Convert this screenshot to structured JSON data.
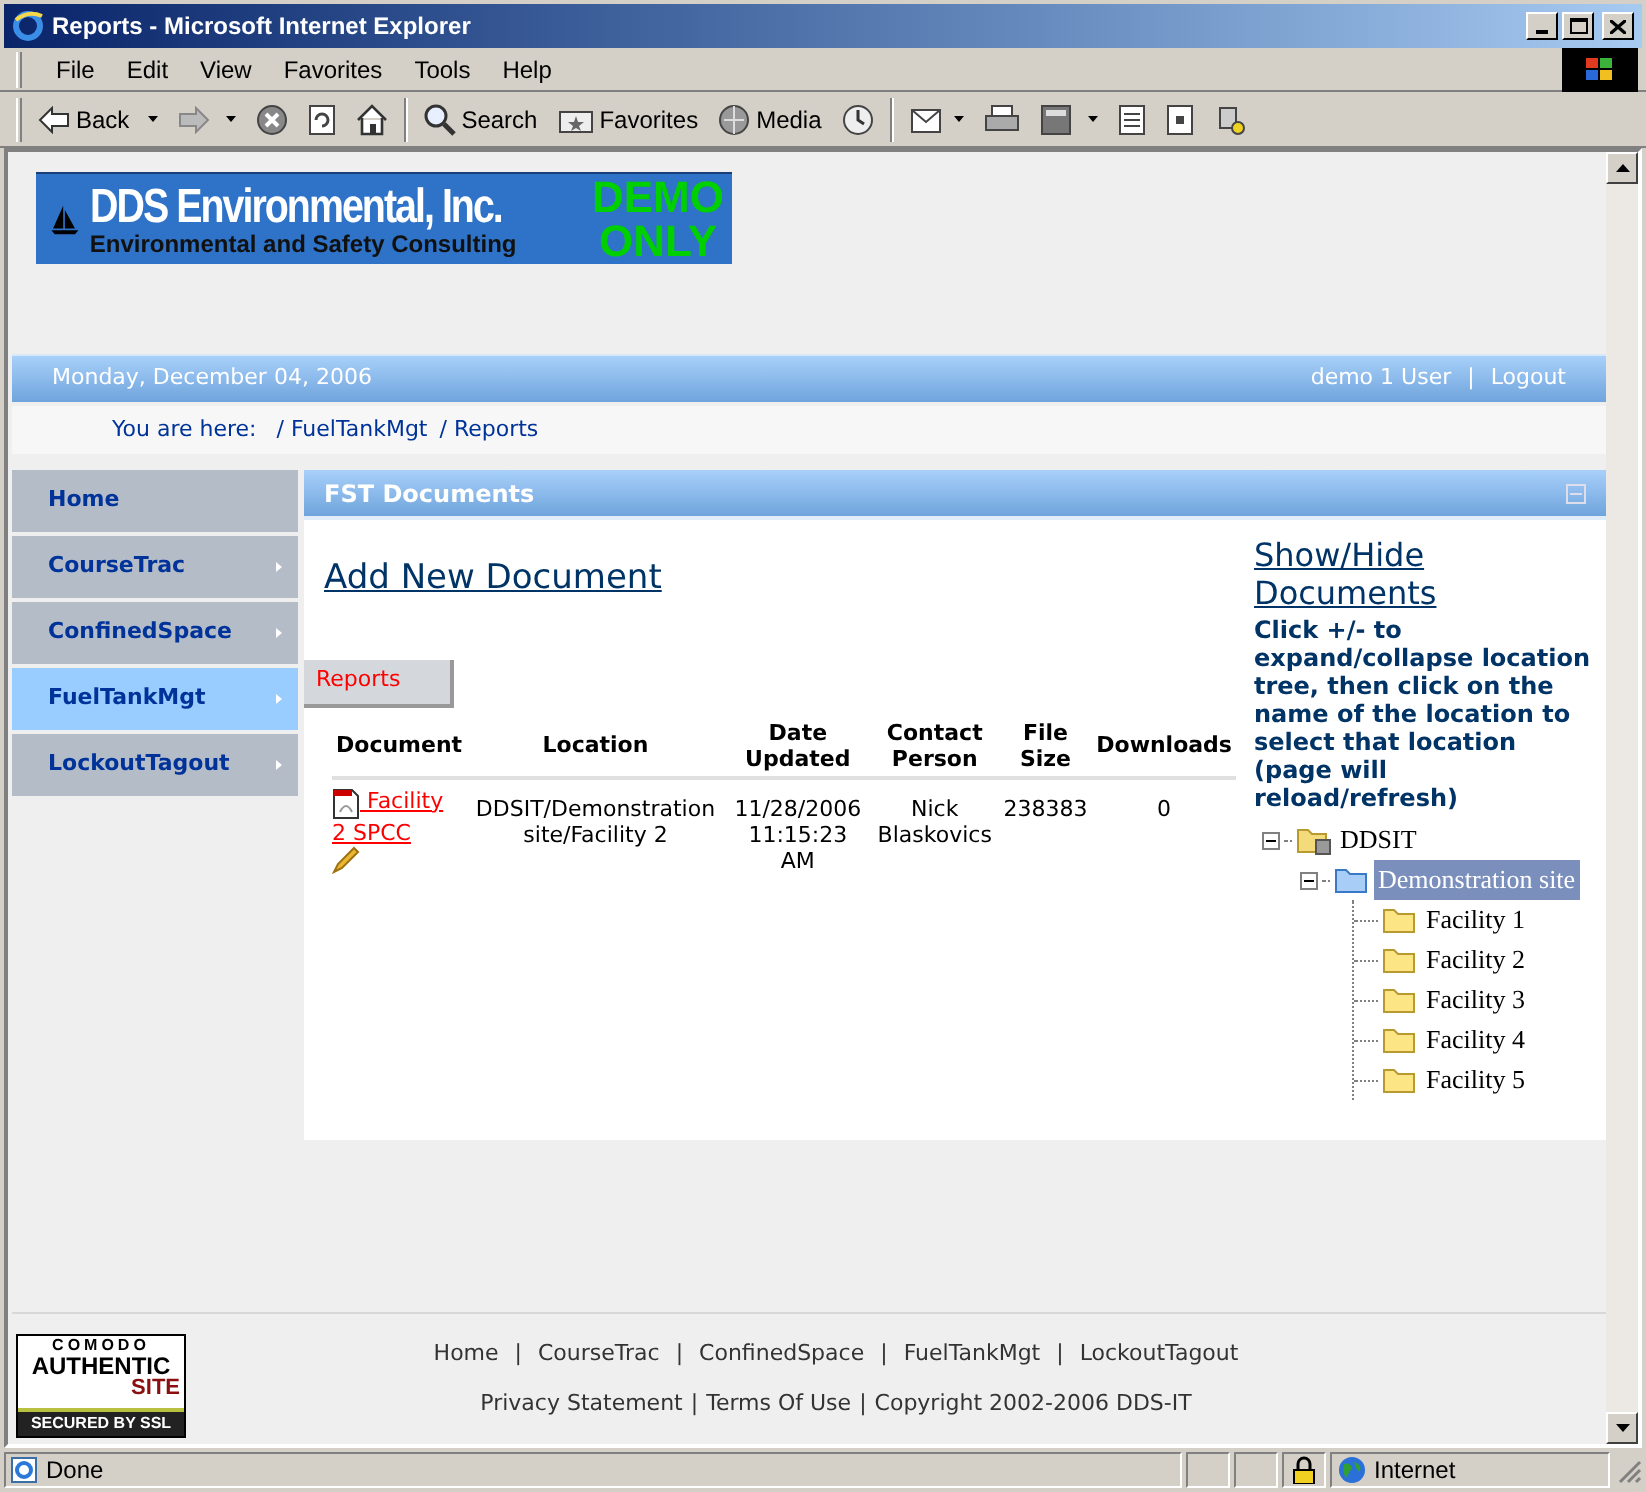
{
  "window": {
    "title": "Reports - Microsoft Internet Explorer"
  },
  "menu_bar": [
    "File",
    "Edit",
    "View",
    "Favorites",
    "Tools",
    "Help"
  ],
  "toolbar": [
    {
      "label": "Back",
      "dropdown": true
    },
    {
      "label": "Search",
      "dropdown": false
    },
    {
      "label": "Favorites",
      "dropdown": false
    },
    {
      "label": "Media",
      "dropdown": false
    }
  ],
  "logo": {
    "name": "DDS Environmental, Inc.",
    "tagline": "Environmental and Safety Consulting",
    "badge": [
      "DEMO",
      "ONLY"
    ]
  },
  "header_bar": {
    "date": "Monday, December 04, 2006",
    "user": "demo 1 User",
    "separator": "|",
    "logout": "Logout"
  },
  "breadcrumb": {
    "label": "You are here:",
    "items": [
      "/ FuelTankMgt",
      "/ Reports"
    ]
  },
  "nav": [
    {
      "label": "Home",
      "selected": false,
      "submenu": false
    },
    {
      "label": "CourseTrac",
      "selected": false,
      "submenu": true
    },
    {
      "label": "ConfinedSpace",
      "selected": false,
      "submenu": true
    },
    {
      "label": "FuelTankMgt",
      "selected": true,
      "submenu": true
    },
    {
      "label": "LockoutTagout",
      "selected": false,
      "submenu": true
    }
  ],
  "panel": {
    "title": "FST Documents",
    "add_link": "Add New Document",
    "subtabs": [
      {
        "label": "Reports",
        "selected": true
      }
    ],
    "table": {
      "columns": [
        "Document",
        "Location",
        "Date Updated",
        "Contact Person",
        "File Size",
        "Downloads"
      ],
      "rows": [
        {
          "document": "Facility 2 SPCC",
          "location": "DDSIT/Demonstration site/Facility 2",
          "date_updated": "11/28/2006 11:15:23 AM",
          "contact_person": "Nick Blaskovics",
          "file_size": "238383",
          "downloads": "0"
        }
      ]
    },
    "toggle_link": "Show/Hide Documents",
    "instructions": "Click +/- to expand/collapse location tree, then click on the name of the location to select that location (page will reload/refresh)",
    "tree": [
      {
        "label": "DDSIT",
        "expanded": true,
        "selected": false,
        "children": [
          {
            "label": "Demonstration site",
            "expanded": true,
            "selected": true,
            "children": [
              {
                "label": "Facility 1",
                "selected": false
              },
              {
                "label": "Facility 2",
                "selected": false
              },
              {
                "label": "Facility 3",
                "selected": false
              },
              {
                "label": "Facility 4",
                "selected": false
              },
              {
                "label": "Facility 5",
                "selected": false
              }
            ]
          }
        ]
      }
    ]
  },
  "footer": {
    "links": [
      "Home",
      "CourseTrac",
      "ConfinedSpace",
      "FuelTankMgt",
      "LockoutTagout"
    ],
    "separator": "|",
    "legal": [
      "Privacy Statement",
      "Terms Of Use",
      "Copyright 2002-2006 DDS-IT"
    ]
  },
  "ssl_seal": {
    "brand": "COMODO",
    "line1": "AUTHENTIC",
    "line2": "SITE",
    "line3": "SECURED BY SSL"
  },
  "status_bar": {
    "text": "Done",
    "zone": "Internet"
  }
}
